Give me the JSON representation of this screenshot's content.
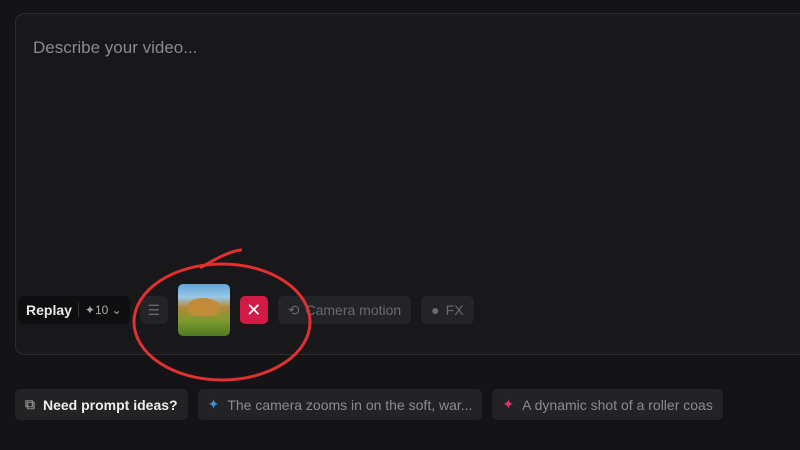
{
  "prompt": {
    "placeholder": "Describe your video..."
  },
  "toolbar": {
    "replay_label": "Replay",
    "credits": "10",
    "camera_motion": "Camera motion",
    "fx": "FX",
    "remove_icon": "close-icon"
  },
  "suggestions": {
    "need_ideas": "Need prompt ideas?",
    "items": [
      "The camera zooms in on the soft, war...",
      "A dynamic shot of a roller coas"
    ]
  },
  "colors": {
    "remove": "#d11a45",
    "blue_sparkle": "#3a8fe0",
    "pink_sparkle": "#e0336a",
    "annotation": "#e03030"
  }
}
